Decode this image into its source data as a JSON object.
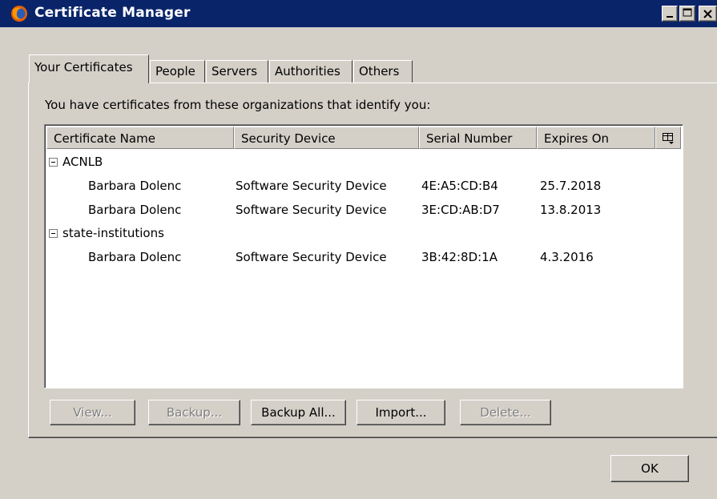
{
  "window": {
    "title": "Certificate Manager"
  },
  "tabs": [
    {
      "label": "Your Certificates",
      "active": true
    },
    {
      "label": "People"
    },
    {
      "label": "Servers"
    },
    {
      "label": "Authorities"
    },
    {
      "label": "Others"
    }
  ],
  "intro_text": "You have certificates from these organizations that identify you:",
  "table": {
    "columns": [
      "Certificate Name",
      "Security Device",
      "Serial Number",
      "Expires On"
    ],
    "column_picker_icon": "column-picker-icon",
    "groups": [
      {
        "name": "ACNLB",
        "rows": [
          {
            "name": "Barbara Dolenc",
            "device": "Software Security Device",
            "serial": "4E:A5:CD:B4",
            "expires": "25.7.2018"
          },
          {
            "name": "Barbara Dolenc",
            "device": "Software Security Device",
            "serial": "3E:CD:AB:D7",
            "expires": "13.8.2013"
          }
        ]
      },
      {
        "name": "state-institutions",
        "rows": [
          {
            "name": "Barbara Dolenc",
            "device": "Software Security Device",
            "serial": "3B:42:8D:1A",
            "expires": "4.3.2016"
          }
        ]
      }
    ]
  },
  "buttons": {
    "view": "View...",
    "backup": "Backup...",
    "backup_all": "Backup All...",
    "import": "Import...",
    "delete": "Delete...",
    "ok": "OK"
  },
  "colors": {
    "titlebar": "#0a246a",
    "face": "#d4d0c8",
    "disabled_text": "#808080"
  }
}
